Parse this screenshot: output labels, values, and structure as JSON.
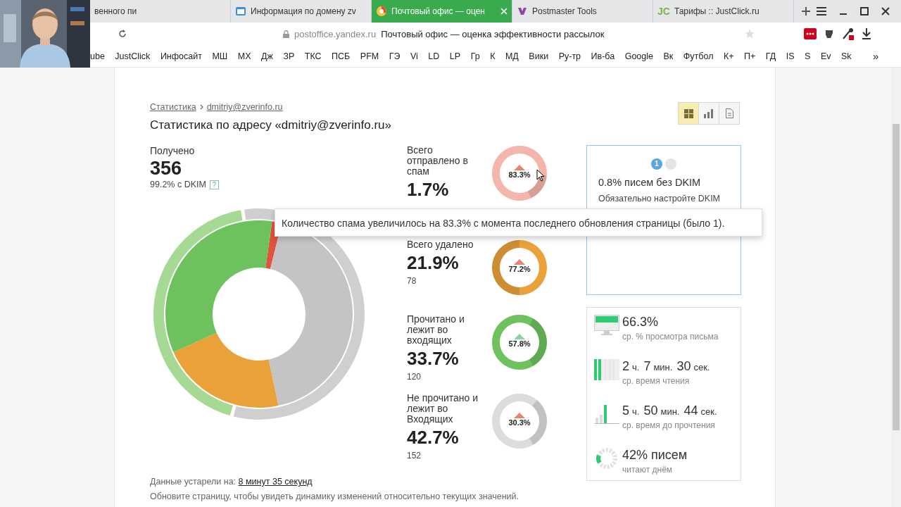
{
  "tabs": [
    {
      "kind": "blank",
      "title": "венного пи",
      "selected": false
    },
    {
      "kind": "page",
      "title": "Информация по домену zv",
      "selected": false
    },
    {
      "kind": "browser",
      "title": "Почтовый офис — оцен",
      "selected": true
    },
    {
      "kind": "tool",
      "title": "Postmaster Tools",
      "selected": false
    },
    {
      "kind": "text-badge",
      "badge": "JC",
      "title": "Тарифы :: JustClick.ru",
      "selected": false
    }
  ],
  "address_bar": {
    "domain": "postoffice.yandex.ru",
    "page_title": "Почтовый офис — оценка эффективности рассылок"
  },
  "bookmarks": [
    "ube",
    "JustClick",
    "Инфосайт",
    "МШ",
    "МХ",
    "Дж",
    "ЗР",
    "ТКС",
    "ПСБ",
    "PFM",
    "ГЭ",
    "Vi",
    "LD",
    "LP",
    "Гр",
    "К",
    "МД",
    "Вики",
    "Ру-тр",
    "Ив-ба",
    "Google",
    "Вк",
    "Футбол",
    "К+",
    "П+",
    "ГД",
    "IS",
    "S",
    "Ev",
    "Sk"
  ],
  "bookmarks_more": "»",
  "breadcrumbs": [
    "Статистика",
    "dmitriy@zverinfo.ru"
  ],
  "page_title": "Статистика по адресу «dmitriy@zverinfo.ru»",
  "view_buttons": [
    {
      "kind": "tiles",
      "selected": true
    },
    {
      "kind": "bars",
      "selected": false
    },
    {
      "kind": "document",
      "selected": false
    }
  ],
  "received": {
    "label": "Получено",
    "value": "356",
    "dkim": "99.2% с DKIM",
    "help": "?"
  },
  "stats": [
    {
      "label": "Всего отправлено в спам",
      "value": "1.7%",
      "change": "83.3%",
      "color": "#f4b5ab",
      "positive": false
    },
    {
      "label": "Всего удалено",
      "value": "21.9%",
      "count": "78",
      "change": "77.2%",
      "color": "#eaa13a",
      "positive": false
    },
    {
      "label": "Прочитано и лежит во входящих",
      "value": "33.7%",
      "count": "120",
      "change": "57.8%",
      "color": "#6ec25e",
      "positive": true
    },
    {
      "label": "Не прочитано и лежит во Входящих",
      "value": "42.7%",
      "count": "152",
      "change": "30.3%",
      "color": "#dcdcdc",
      "positive": false
    }
  ],
  "tip_panel": {
    "pages": [
      {
        "label": "1",
        "selected": true
      },
      {
        "selected": false
      }
    ],
    "title": "0.8% писем без DKIM",
    "text": "Обязательно настройте DKIM"
  },
  "metrics": [
    {
      "kind": "screen",
      "parts": [
        {
          "number": "66.3%"
        }
      ],
      "caption": "ср. % просмотра письма"
    },
    {
      "kind": "bars",
      "parts": [
        {
          "number": "2",
          "unit": "ч."
        },
        {
          "number": "7",
          "unit": "мин."
        },
        {
          "number": "30",
          "unit": "сек."
        }
      ],
      "caption": "ср. время чтения"
    },
    {
      "kind": "histogram",
      "parts": [
        {
          "number": "5",
          "unit": "ч."
        },
        {
          "number": "50",
          "unit": "мин."
        },
        {
          "number": "44",
          "unit": "сек."
        }
      ],
      "caption": "ср. время до прочтения"
    },
    {
      "kind": "clock",
      "parts": [
        {
          "number": "42% писем"
        }
      ],
      "caption": "читают днём"
    }
  ],
  "footer": {
    "stale_label": "Данные устарели на:",
    "stale_value": "8 минут 35 секунд",
    "hint": "Обновите страницу, чтобы увидеть динамику изменений относительно текущих значений."
  },
  "tooltip": "Количество спама увеличилось на 83.3% с момента последнего обновления страницы (было 1)."
}
